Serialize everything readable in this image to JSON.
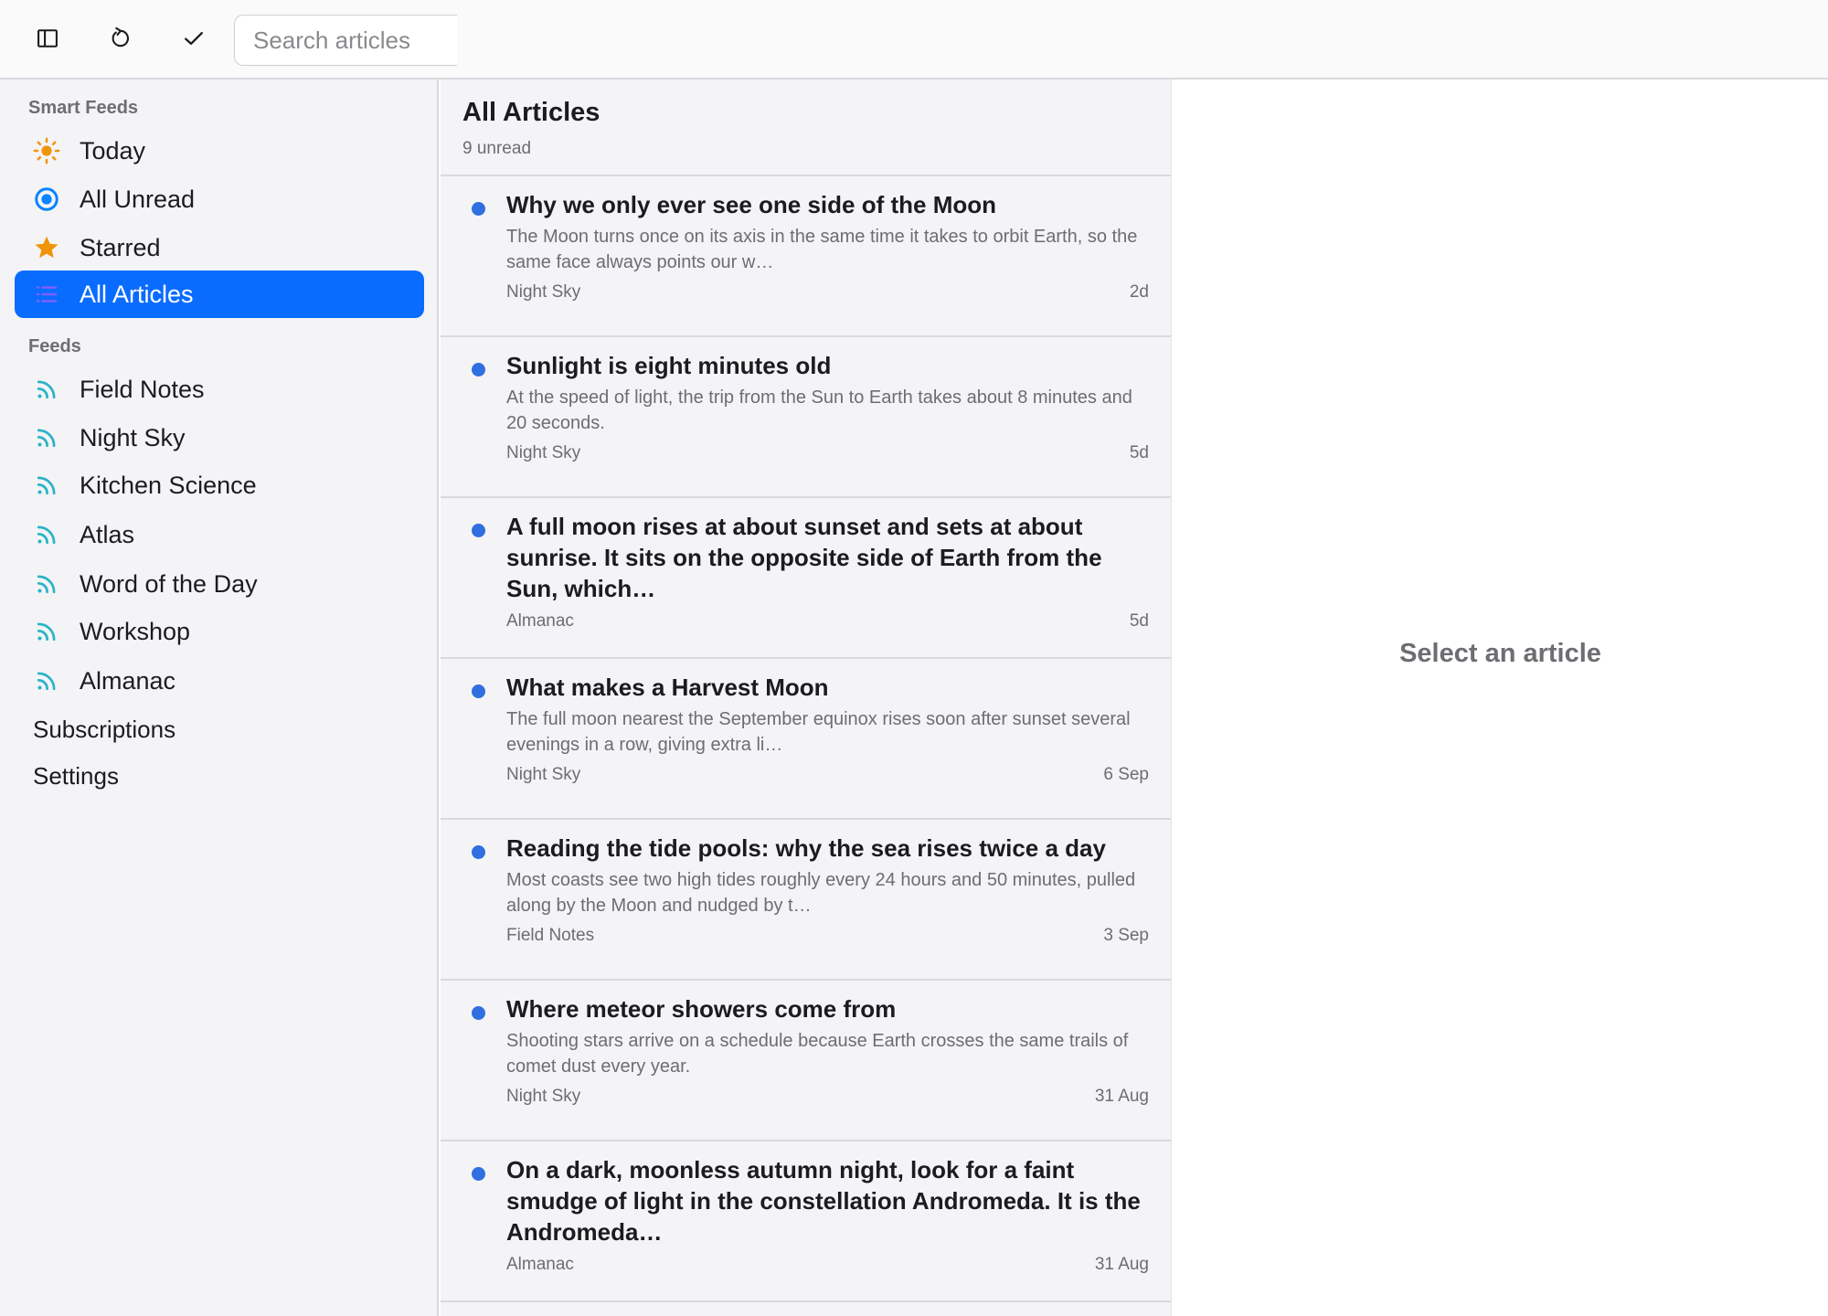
{
  "toolbar": {
    "sidebar_toggle_icon": "sidebar-icon",
    "refresh_icon": "refresh-icon",
    "mark_read_icon": "checkmark-icon",
    "search_placeholder": "Search articles",
    "search_value": ""
  },
  "sidebar": {
    "smart_feeds_title": "Smart Feeds",
    "smart_feeds": [
      {
        "label": "Today",
        "icon": "sun-icon",
        "color": "#f0940a"
      },
      {
        "label": "All Unread",
        "icon": "unread-circle-icon",
        "color": "#0a84ff"
      },
      {
        "label": "Starred",
        "icon": "star-icon",
        "color": "#f0940a"
      },
      {
        "label": "All Articles",
        "icon": "list-icon",
        "color": "#7b61ff",
        "selected": true
      }
    ],
    "feeds_title": "Feeds",
    "feeds": [
      {
        "label": "Field Notes",
        "icon": "rss-icon"
      },
      {
        "label": "Night Sky",
        "icon": "rss-icon"
      },
      {
        "label": "Kitchen Science",
        "icon": "rss-icon"
      },
      {
        "label": "Atlas",
        "icon": "rss-icon"
      },
      {
        "label": "Word of the Day",
        "icon": "rss-icon"
      },
      {
        "label": "Workshop",
        "icon": "rss-icon"
      },
      {
        "label": "Almanac",
        "icon": "rss-icon"
      }
    ],
    "feed_icon_color": "#2ab3c7",
    "subscriptions_label": "Subscriptions",
    "settings_label": "Settings",
    "accent": "#0a6cff"
  },
  "list": {
    "title": "All Articles",
    "subtitle": "9 unread",
    "unread_dot_color": "#2f6fe0",
    "articles": [
      {
        "title": "Why we only ever see one side of the Moon",
        "summary": "The Moon turns once on its axis in the same time it takes to orbit Earth, so the same face always points our w…",
        "feed": "Night Sky",
        "age": "2d"
      },
      {
        "title": "Sunlight is eight minutes old",
        "summary": "At the speed of light, the trip from the Sun to Earth takes about 8 minutes and 20 seconds.",
        "feed": "Night Sky",
        "age": "5d"
      },
      {
        "title": "A full moon rises at about sunset and sets at about sunrise. It sits on the opposite side of Earth from the Sun, which…",
        "summary": "",
        "feed": "Almanac",
        "age": "5d"
      },
      {
        "title": "What makes a Harvest Moon",
        "summary": "The full moon nearest the September equinox rises soon after sunset several evenings in a row, giving extra li…",
        "feed": "Night Sky",
        "age": "6 Sep"
      },
      {
        "title": "Reading the tide pools: why the sea rises twice a day",
        "summary": "Most coasts see two high tides roughly every 24 hours and 50 minutes, pulled along by the Moon and nudged by t…",
        "feed": "Field Notes",
        "age": "3 Sep"
      },
      {
        "title": "Where meteor showers come from",
        "summary": "Shooting stars arrive on a schedule because Earth crosses the same trails of comet dust every year.",
        "feed": "Night Sky",
        "age": "31 Aug"
      },
      {
        "title": "On a dark, moonless autumn night, look for a faint smudge of light in the constellation Andromeda. It is the Andromeda…",
        "summary": "",
        "feed": "Almanac",
        "age": "31 Aug"
      }
    ]
  },
  "detail": {
    "empty_text": "Select an article"
  }
}
